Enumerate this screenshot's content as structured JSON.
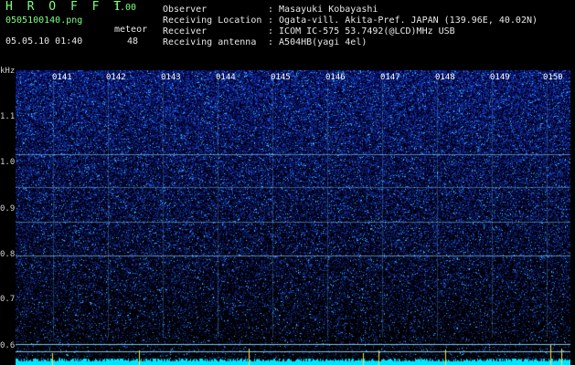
{
  "header": {
    "brand": "H R O F F T",
    "version": "1.00",
    "filename": "0505100140.png",
    "category": "meteor",
    "datetime": "05.05.10 01:40",
    "count": "48"
  },
  "info": [
    {
      "key": "Observer",
      "value": ": Masayuki Kobayashi"
    },
    {
      "key": "Receiving Location",
      "value": ": Ogata-vill. Akita-Pref. JAPAN (139.96E, 40.02N)"
    },
    {
      "key": "Receiver",
      "value": ": ICOM IC-575 53.7492(@LCD)MHz USB"
    },
    {
      "key": "Receiving antenna",
      "value": ": A504HB(yagi 4el)"
    }
  ],
  "y_axis": {
    "unit": "kHz",
    "ticks": [
      "1.1",
      "1.0",
      "0.9",
      "0.8",
      "0.7",
      "0.6"
    ]
  },
  "x_axis": {
    "ticks": [
      "0141",
      "0142",
      "0143",
      "0144",
      "0145",
      "0146",
      "0147",
      "0148",
      "0149",
      "0150"
    ]
  },
  "colors": {
    "background": "#000000",
    "signal": "#1a3a8f",
    "noise_hi": "#40c0ff",
    "baseline": "#00e5ff",
    "grid": "#7fd0ff"
  }
}
